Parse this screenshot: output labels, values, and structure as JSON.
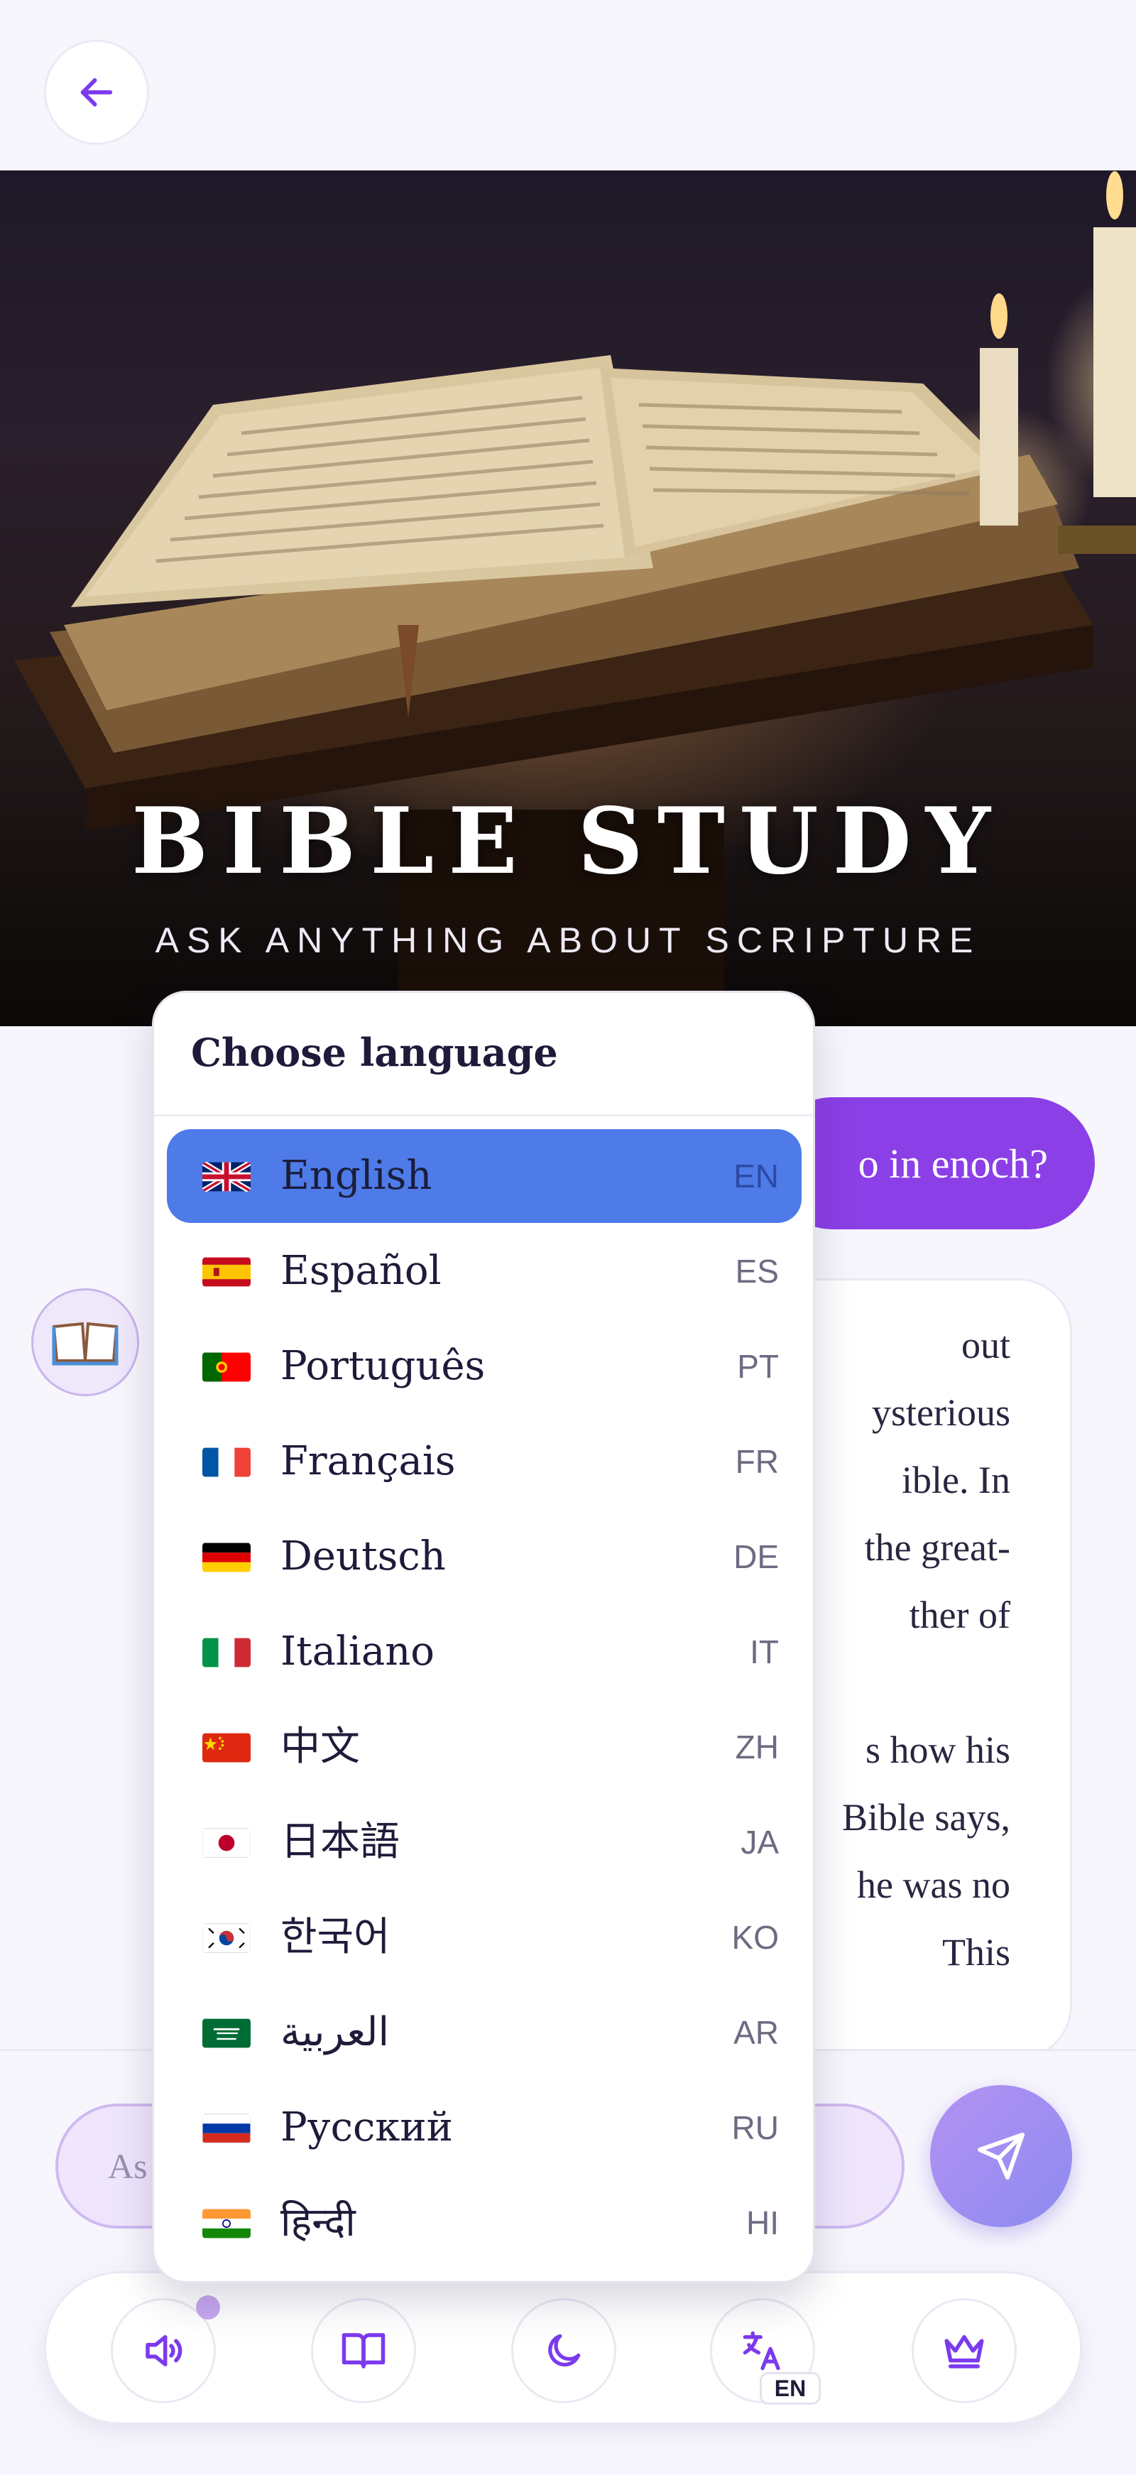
{
  "hero": {
    "title": "BIBLE STUDY",
    "subtitle": "ASK ANYTHING ABOUT SCRIPTURE"
  },
  "chat": {
    "user_message_visible": "o in enoch?",
    "bot_lines_visible": [
      "out",
      "ysterious",
      "ible. In",
      "the great-",
      "ther of",
      "s how his",
      "Bible says,",
      "he was no",
      "This"
    ]
  },
  "composer": {
    "placeholder": "As"
  },
  "language_menu": {
    "title": "Choose language",
    "selected": "EN",
    "options": [
      {
        "name": "English",
        "code": "EN"
      },
      {
        "name": "Español",
        "code": "ES"
      },
      {
        "name": "Português",
        "code": "PT"
      },
      {
        "name": "Français",
        "code": "FR"
      },
      {
        "name": "Deutsch",
        "code": "DE"
      },
      {
        "name": "Italiano",
        "code": "IT"
      },
      {
        "name": "中文",
        "code": "ZH"
      },
      {
        "name": "日本語",
        "code": "JA"
      },
      {
        "name": "한국어",
        "code": "KO"
      },
      {
        "name": "العربية",
        "code": "AR"
      },
      {
        "name": "Русский",
        "code": "RU"
      },
      {
        "name": "हिन्दी",
        "code": "HI"
      }
    ]
  },
  "toolbar": {
    "items": [
      {
        "icon": "speaker-icon"
      },
      {
        "icon": "book-icon"
      },
      {
        "icon": "moon-icon"
      },
      {
        "icon": "translate-icon",
        "badge": "EN"
      },
      {
        "icon": "crown-icon"
      }
    ]
  },
  "colors": {
    "accent": "#8b3fe6",
    "selected_language": "#4e7be8",
    "background": "#f7f6fc"
  }
}
